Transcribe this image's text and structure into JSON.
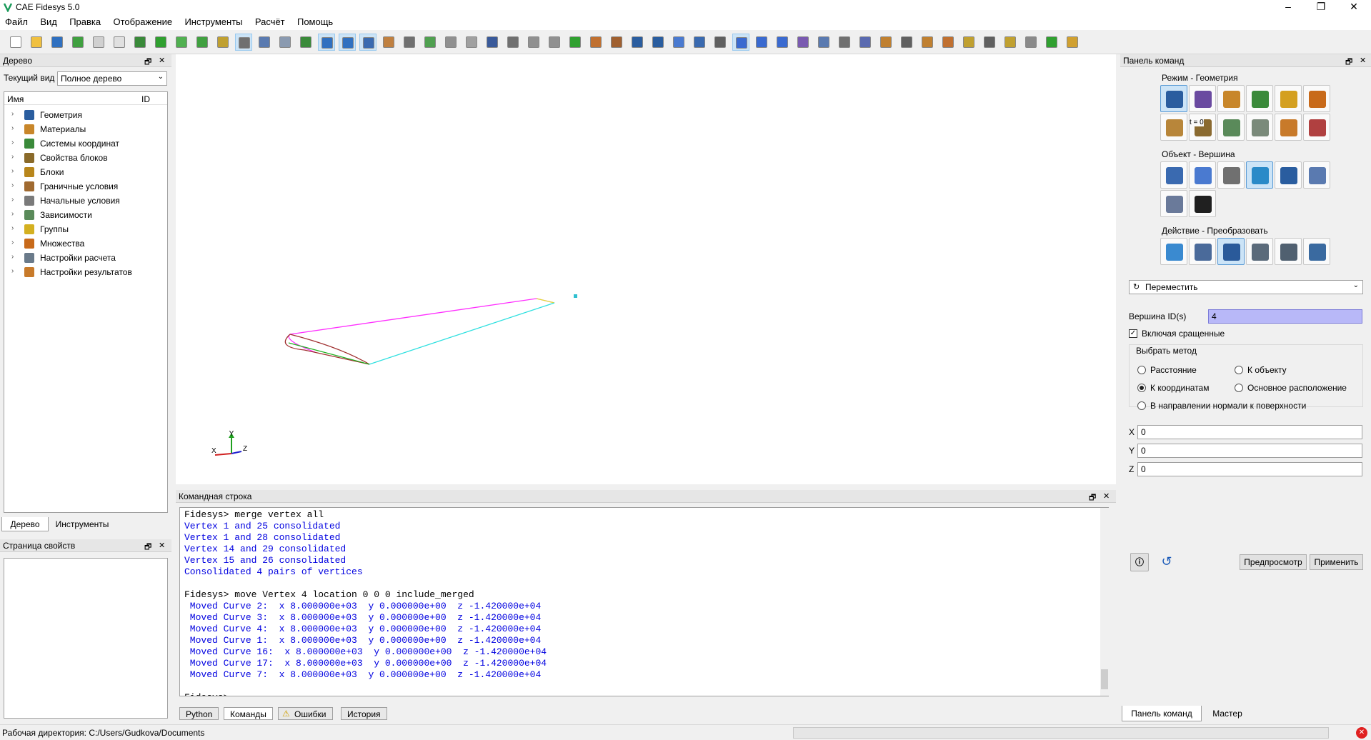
{
  "window": {
    "title": "CAE Fidesys 5.0"
  },
  "menu": [
    "Файл",
    "Вид",
    "Правка",
    "Отображение",
    "Инструменты",
    "Расчёт",
    "Помощь"
  ],
  "tree_panel": {
    "title": "Дерево",
    "view_label": "Текущий вид",
    "view_value": "Полное дерево",
    "col_name": "Имя",
    "col_id": "ID",
    "items": [
      {
        "label": "Геометрия",
        "icon": "geometry-icon",
        "color": "#2a5d9f"
      },
      {
        "label": "Материалы",
        "icon": "materials-icon",
        "color": "#c8862a"
      },
      {
        "label": "Системы координат",
        "icon": "coordinate-system-icon",
        "color": "#3a8a3a"
      },
      {
        "label": "Свойства блоков",
        "icon": "block-properties-icon",
        "color": "#8a6a2a"
      },
      {
        "label": "Блоки",
        "icon": "blocks-icon",
        "color": "#b8861b"
      },
      {
        "label": "Граничные условия",
        "icon": "boundary-conditions-icon",
        "color": "#a06a30"
      },
      {
        "label": "Начальные условия",
        "icon": "initial-conditions-icon",
        "color": "#7a7a7a"
      },
      {
        "label": "Зависимости",
        "icon": "dependencies-icon",
        "color": "#5a8a5a"
      },
      {
        "label": "Группы",
        "icon": "groups-icon",
        "color": "#d4b020"
      },
      {
        "label": "Множества",
        "icon": "sets-icon",
        "color": "#c86a1a"
      },
      {
        "label": "Настройки расчета",
        "icon": "calc-settings-icon",
        "color": "#6a7a8a"
      },
      {
        "label": "Настройки результатов",
        "icon": "result-settings-icon",
        "color": "#c87a2a"
      }
    ],
    "tabs": [
      "Дерево",
      "Инструменты"
    ]
  },
  "props_panel": {
    "title": "Страница свойств"
  },
  "cmdline": {
    "title": "Командная строка",
    "lines": [
      {
        "type": "cmd",
        "text": "Fidesys> merge vertex all"
      },
      {
        "type": "out",
        "text": "Vertex 1 and 25 consolidated"
      },
      {
        "type": "out",
        "text": "Vertex 1 and 28 consolidated"
      },
      {
        "type": "out",
        "text": "Vertex 14 and 29 consolidated"
      },
      {
        "type": "out",
        "text": "Vertex 15 and 26 consolidated"
      },
      {
        "type": "out",
        "text": "Consolidated 4 pairs of vertices"
      },
      {
        "type": "blank",
        "text": ""
      },
      {
        "type": "cmd",
        "text": "Fidesys> move Vertex 4 location 0 0 0 include_merged"
      },
      {
        "type": "out",
        "text": " Moved Curve 2:  x 8.000000e+03  y 0.000000e+00  z -1.420000e+04"
      },
      {
        "type": "out",
        "text": " Moved Curve 3:  x 8.000000e+03  y 0.000000e+00  z -1.420000e+04"
      },
      {
        "type": "out",
        "text": " Moved Curve 4:  x 8.000000e+03  y 0.000000e+00  z -1.420000e+04"
      },
      {
        "type": "out",
        "text": " Moved Curve 1:  x 8.000000e+03  y 0.000000e+00  z -1.420000e+04"
      },
      {
        "type": "out",
        "text": " Moved Curve 16:  x 8.000000e+03  y 0.000000e+00  z -1.420000e+04"
      },
      {
        "type": "out",
        "text": " Moved Curve 17:  x 8.000000e+03  y 0.000000e+00  z -1.420000e+04"
      },
      {
        "type": "out",
        "text": " Moved Curve 7:  x 8.000000e+03  y 0.000000e+00  z -1.420000e+04"
      },
      {
        "type": "blank",
        "text": ""
      },
      {
        "type": "cmd",
        "text": "Fidesys> "
      }
    ],
    "tabs": [
      "Python",
      "Команды",
      "Ошибки",
      "История"
    ]
  },
  "command_panel": {
    "title": "Панель команд",
    "mode_label": "Режим - Геометрия",
    "object_label": "Объект - Вершина",
    "action_label": "Действие - Преобразовать",
    "t0_label": "t = 0",
    "operation": "Переместить",
    "vertex_label": "Вершина ID(s)",
    "vertex_value": "4",
    "include_merged": "Включая сращенные",
    "method_label": "Выбрать метод",
    "methods": {
      "distance": "Расстояние",
      "to_object": "К объекту",
      "to_coords": "К координатам",
      "base_location": "Основное расположение",
      "normal": "В направлении нормали к поверхности"
    },
    "x_label": "X",
    "x_value": "0",
    "y_label": "Y",
    "y_value": "0",
    "z_label": "Z",
    "z_value": "0",
    "preview": "Предпросмотр",
    "apply": "Применить",
    "tabs": [
      "Панель команд",
      "Мастер"
    ]
  },
  "triad": {
    "x": "X",
    "y": "Y",
    "z": "Z"
  },
  "status": {
    "workdir": "Рабочая директория: C:/Users/Gudkova/Documents"
  }
}
